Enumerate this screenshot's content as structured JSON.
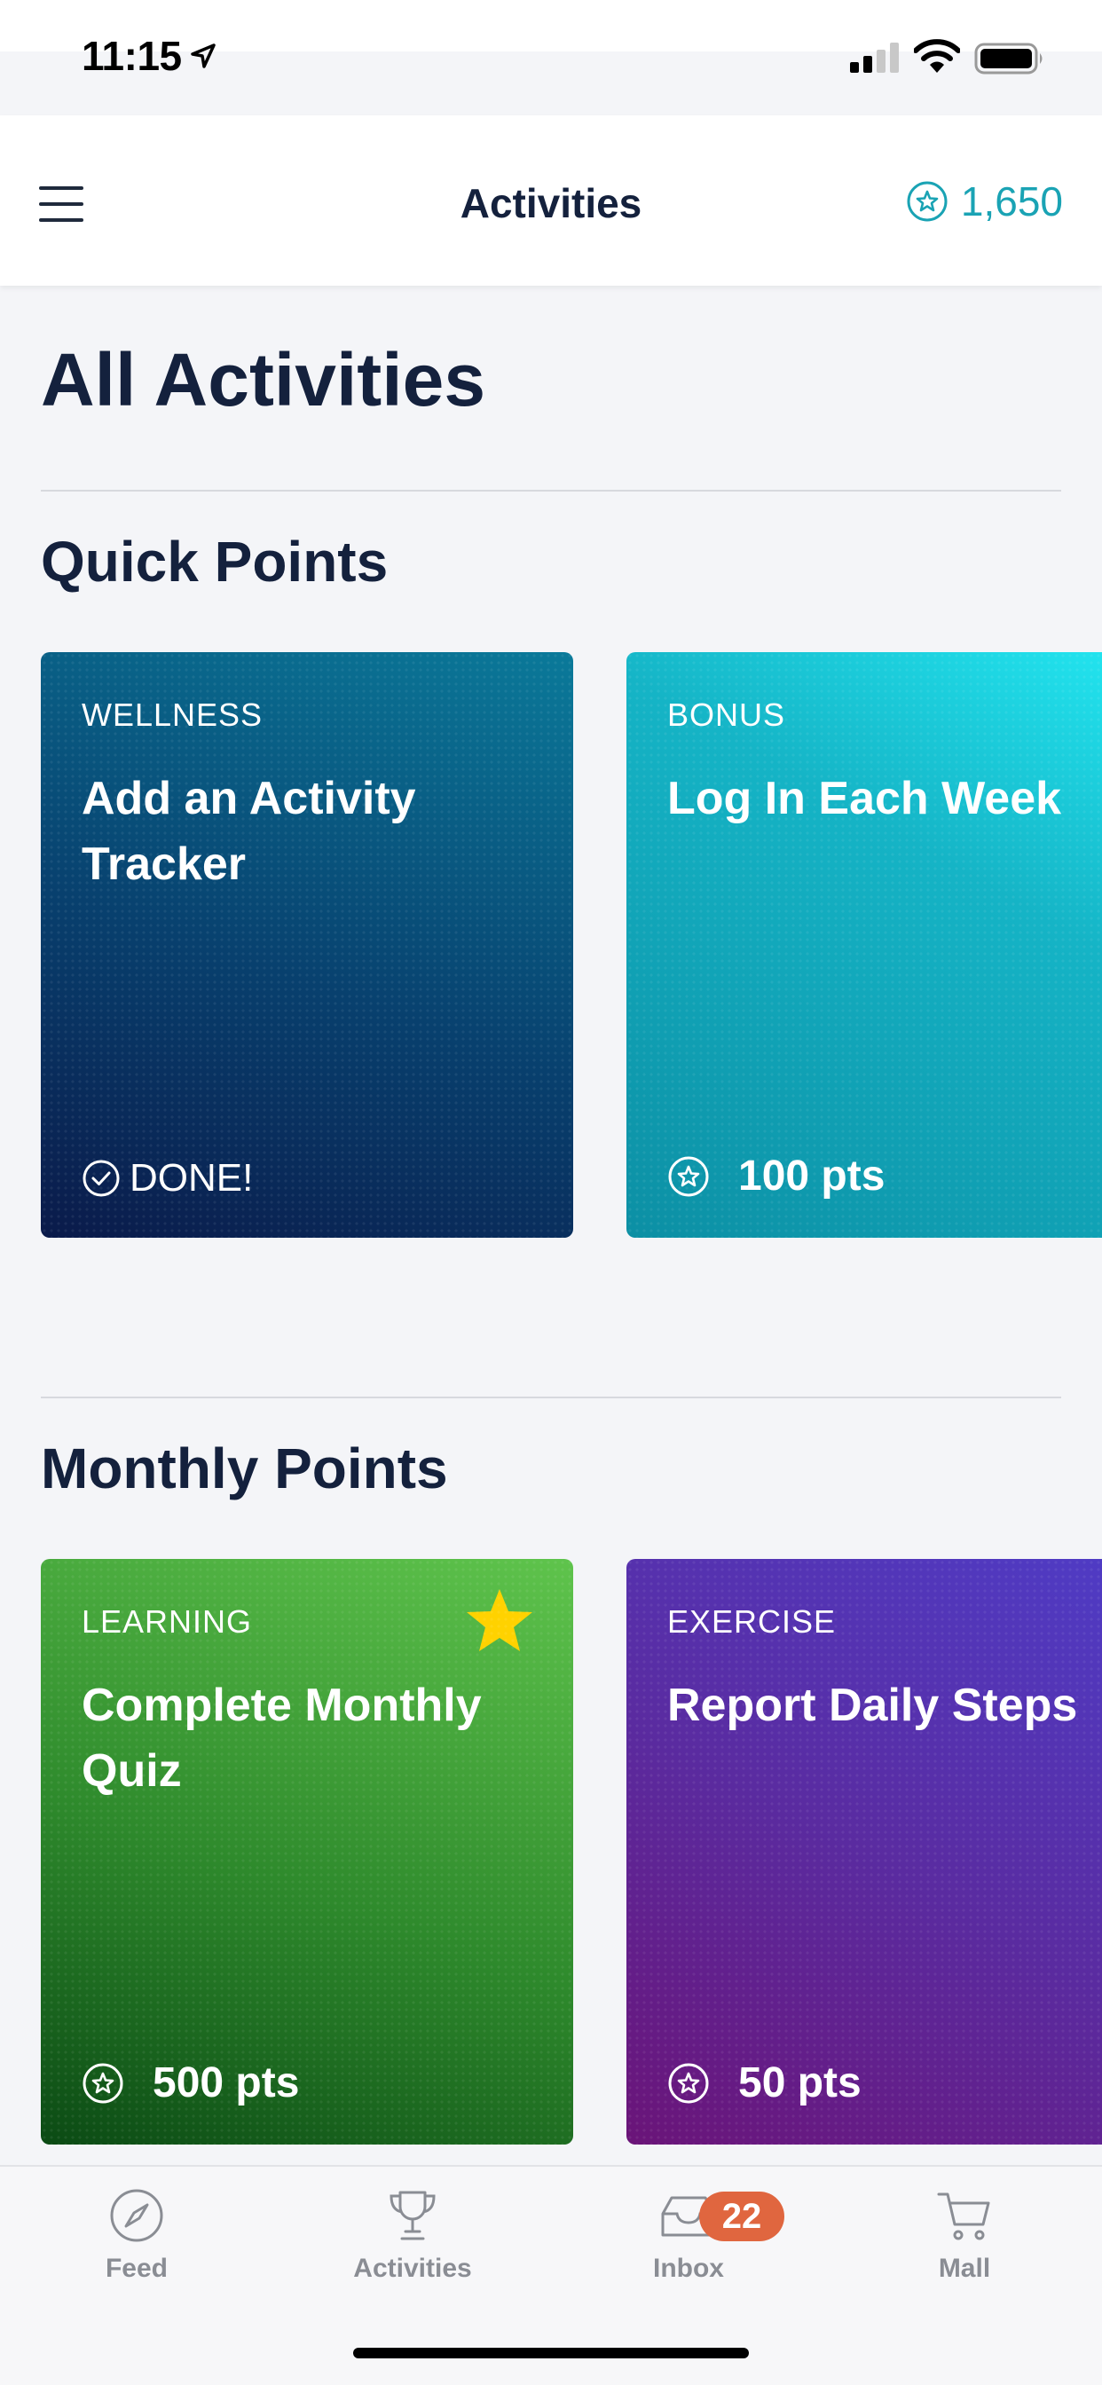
{
  "status_bar": {
    "time": "11:15"
  },
  "header": {
    "title": "Activities",
    "points": "1,650"
  },
  "page_title": "All Activities",
  "sections": [
    {
      "title": "Quick Points",
      "cards": [
        {
          "category": "WELLNESS",
          "title": "Add an Activity Tracker",
          "footer": "DONE!",
          "footer_icon": "check-circle-icon"
        },
        {
          "category": "BONUS",
          "title": "Log In Each Week",
          "footer": "100 pts",
          "footer_icon": "star-circle-icon"
        }
      ]
    },
    {
      "title": "Monthly Points",
      "cards": [
        {
          "category": "LEARNING",
          "title": "Complete Monthly Quiz",
          "footer": "500 pts",
          "footer_icon": "star-circle-icon",
          "featured": true
        },
        {
          "category": "EXERCISE",
          "title": "Report Daily Steps",
          "footer": "50 pts",
          "footer_icon": "star-circle-icon"
        }
      ]
    }
  ],
  "tab_bar": {
    "tabs": [
      {
        "label": "Feed",
        "icon": "compass-icon"
      },
      {
        "label": "Activities",
        "icon": "trophy-icon"
      },
      {
        "label": "Inbox",
        "icon": "inbox-icon",
        "badge": "22"
      },
      {
        "label": "Mall",
        "icon": "cart-icon"
      }
    ]
  },
  "colors": {
    "accent": "#1aa3b4",
    "badge": "#e0663f",
    "featured_star": "#ffd200"
  }
}
